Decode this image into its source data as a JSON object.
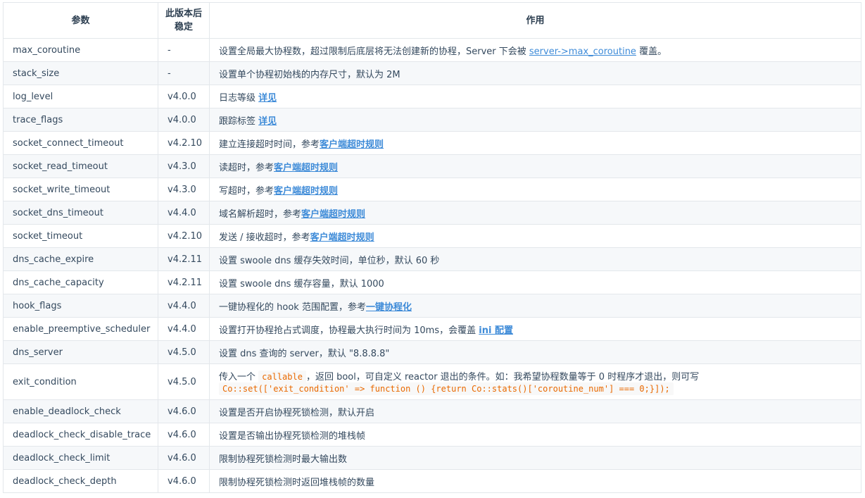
{
  "headers": {
    "param": "参数",
    "since": "此版本后稳定",
    "effect": "作用"
  },
  "rows": [
    {
      "name": "max_coroutine",
      "version": "-",
      "desc": "设置全局最大协程数，超过限制后底层将无法创建新的协程，Server 下会被 ",
      "link": "server->max_coroutine",
      "after": " 覆盖。"
    },
    {
      "name": "stack_size",
      "version": "-",
      "desc": "设置单个协程初始栈的内存尺寸，默认为 2M"
    },
    {
      "name": "log_level",
      "version": "v4.0.0",
      "desc": "日志等级 ",
      "link": "详见"
    },
    {
      "name": "trace_flags",
      "version": "v4.0.0",
      "desc": "跟踪标签 ",
      "link": "详见"
    },
    {
      "name": "socket_connect_timeout",
      "version": "v4.2.10",
      "desc": "建立连接超时时间，参考",
      "link": "客户端超时规则"
    },
    {
      "name": "socket_read_timeout",
      "version": "v4.3.0",
      "desc": "读超时，参考",
      "link": "客户端超时规则"
    },
    {
      "name": "socket_write_timeout",
      "version": "v4.3.0",
      "desc": "写超时，参考",
      "link": "客户端超时规则"
    },
    {
      "name": "socket_dns_timeout",
      "version": "v4.4.0",
      "desc": "域名解析超时，参考",
      "link": "客户端超时规则"
    },
    {
      "name": "socket_timeout",
      "version": "v4.2.10",
      "desc": "发送 / 接收超时，参考",
      "link": "客户端超时规则"
    },
    {
      "name": "dns_cache_expire",
      "version": "v4.2.11",
      "desc": "设置 swoole dns 缓存失效时间，单位秒，默认 60 秒"
    },
    {
      "name": "dns_cache_capacity",
      "version": "v4.2.11",
      "desc": "设置 swoole dns 缓存容量，默认 1000"
    },
    {
      "name": "hook_flags",
      "version": "v4.4.0",
      "desc": "一键协程化的 hook 范围配置，参考",
      "link": "一键协程化"
    },
    {
      "name": "enable_preemptive_scheduler",
      "version": "v4.4.0",
      "desc": "设置打开协程抢占式调度，协程最大执行时间为 10ms，会覆盖 ",
      "link": "ini 配置"
    },
    {
      "name": "dns_server",
      "version": "v4.5.0",
      "desc": "设置 dns 查询的 server，默认 \"8.8.8.8\""
    },
    {
      "name": "exit_condition",
      "version": "v4.5.0",
      "desc": "传入一个 ",
      "code": "callable",
      "after": "，返回 bool，可自定义 reactor 退出的条件。如：我希望协程数量等于 0 时程序才退出，则可写",
      "code2": "Co::set(['exit_condition' => function () {return Co::stats()['coroutine_num'] === 0;}]);"
    },
    {
      "name": "enable_deadlock_check",
      "version": "v4.6.0",
      "desc": "设置是否开启协程死锁检测，默认开启"
    },
    {
      "name": "deadlock_check_disable_trace",
      "version": "v4.6.0",
      "desc": "设置是否输出协程死锁检测的堆栈帧"
    },
    {
      "name": "deadlock_check_limit",
      "version": "v4.6.0",
      "desc": "限制协程死锁检测时最大输出数"
    },
    {
      "name": "deadlock_check_depth",
      "version": "v4.6.0",
      "desc": "限制协程死锁检测时返回堆栈帧的数量"
    }
  ]
}
